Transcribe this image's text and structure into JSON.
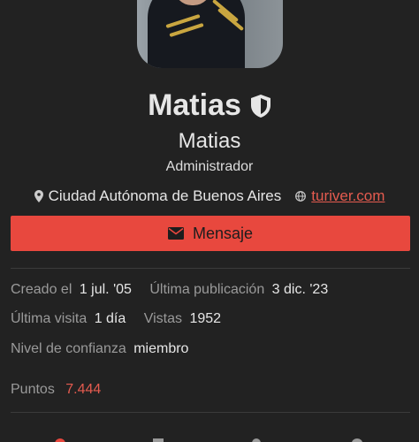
{
  "profile": {
    "username": "Matias",
    "full_name": "Matias",
    "title": "Administrador",
    "location": "Ciudad Autónoma de Buenos Aires",
    "website": "turiver.com"
  },
  "actions": {
    "message_label": "Mensaje"
  },
  "stats": {
    "created_label": "Creado el",
    "created_value": "1 jul. '05",
    "last_post_label": "Última publicación",
    "last_post_value": "3 dic. '23",
    "last_seen_label": "Última visita",
    "last_seen_value": "1 día",
    "views_label": "Vistas",
    "views_value": "1952",
    "trust_label": "Nivel de confianza",
    "trust_value": "miembro",
    "points_label": "Puntos",
    "points_value": "7.444"
  },
  "icons": {
    "moderator_badge": "shield-icon",
    "location": "map-marker-icon",
    "website": "globe-icon",
    "message": "envelope-icon"
  },
  "colors": {
    "background": "#222222",
    "accent": "#e8483e",
    "link": "#e45b4f",
    "muted_text": "#9a9a9a",
    "text": "#e6e6e6"
  }
}
